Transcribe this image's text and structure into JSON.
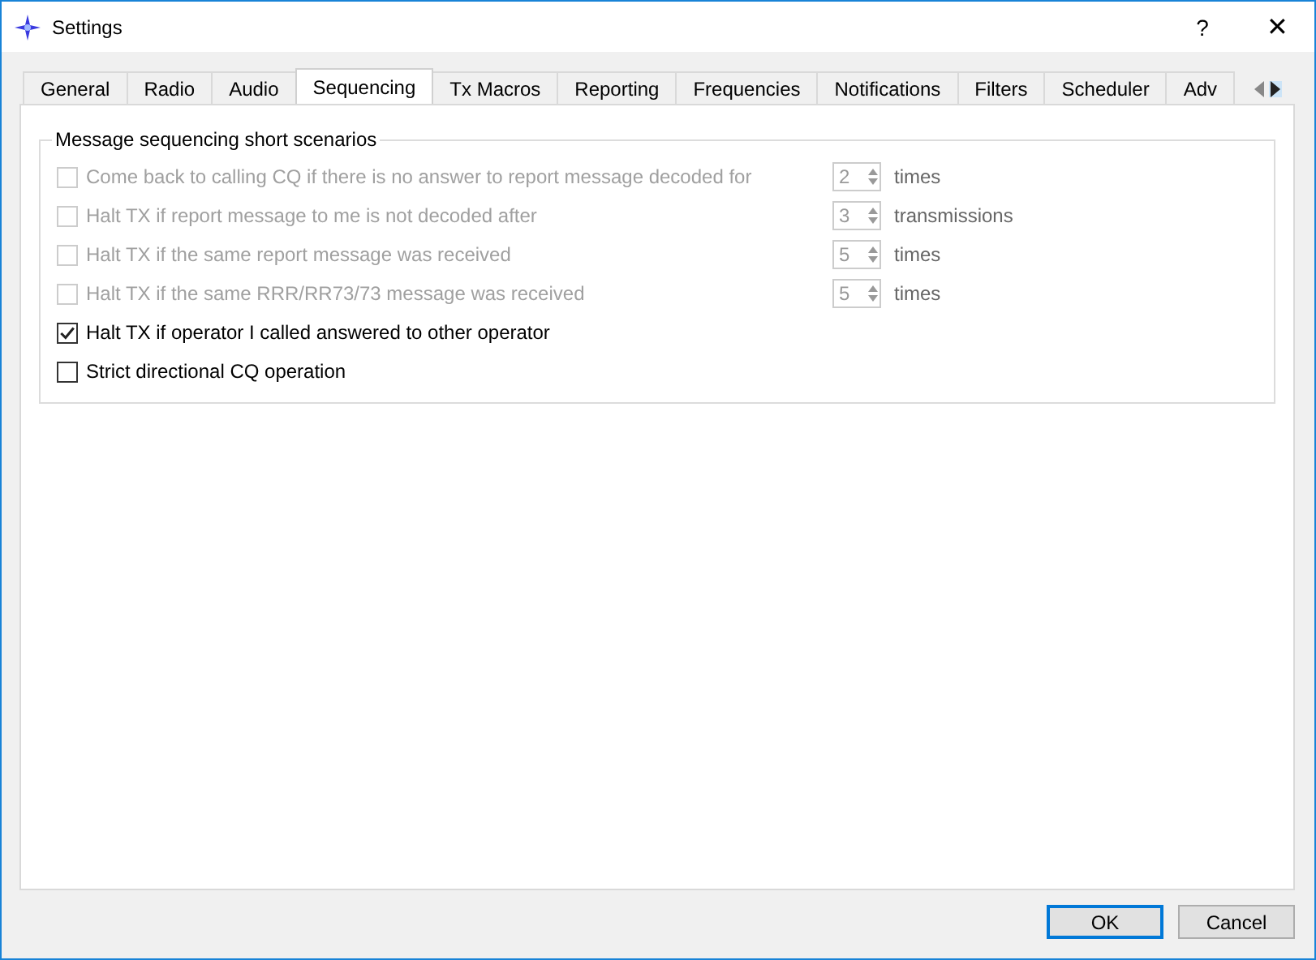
{
  "window": {
    "title": "Settings",
    "help": "?",
    "close": "✕"
  },
  "tabs": [
    {
      "label": "General",
      "selected": false
    },
    {
      "label": "Radio",
      "selected": false
    },
    {
      "label": "Audio",
      "selected": false
    },
    {
      "label": "Sequencing",
      "selected": true
    },
    {
      "label": "Tx Macros",
      "selected": false
    },
    {
      "label": "Reporting",
      "selected": false
    },
    {
      "label": "Frequencies",
      "selected": false
    },
    {
      "label": "Notifications",
      "selected": false
    },
    {
      "label": "Filters",
      "selected": false
    },
    {
      "label": "Scheduler",
      "selected": false
    },
    {
      "label": "Adv",
      "selected": false
    }
  ],
  "group": {
    "title": "Message sequencing short scenarios",
    "options": [
      {
        "kind": "spin",
        "label": "Come back to calling CQ if there is no answer to report message decoded for",
        "checked": false,
        "disabled": true,
        "value": "2",
        "unit": "times"
      },
      {
        "kind": "spin",
        "label": "Halt TX if report message to me is not decoded after",
        "checked": false,
        "disabled": true,
        "value": "3",
        "unit": "transmissions"
      },
      {
        "kind": "spin",
        "label": "Halt TX if the same report message was received",
        "checked": false,
        "disabled": true,
        "value": "5",
        "unit": "times"
      },
      {
        "kind": "spin",
        "label": "Halt TX if the same RRR/RR73/73 message was received",
        "checked": false,
        "disabled": true,
        "value": "5",
        "unit": "times"
      },
      {
        "kind": "check",
        "label": "Halt TX if operator I called answered to other operator",
        "checked": true,
        "disabled": false
      },
      {
        "kind": "check",
        "label": "Strict directional CQ operation",
        "checked": false,
        "disabled": false
      }
    ]
  },
  "buttons": [
    {
      "label": "OK",
      "selected": true
    },
    {
      "label": "Cancel",
      "selected": false
    }
  ]
}
